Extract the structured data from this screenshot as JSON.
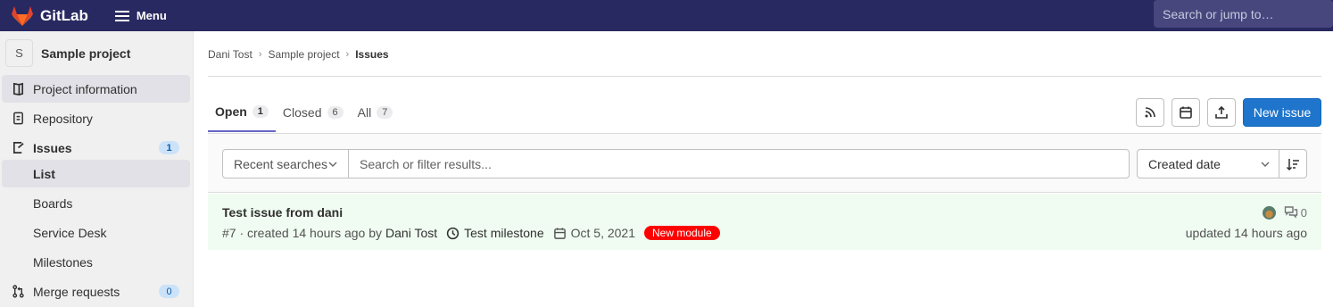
{
  "navbar": {
    "brand": "GitLab",
    "menu_label": "Menu",
    "search_placeholder": "Search or jump to…"
  },
  "sidebar": {
    "project_avatar_letter": "S",
    "project_name": "Sample project",
    "items": [
      {
        "label": "Project information",
        "icon": "book-icon"
      },
      {
        "label": "Repository",
        "icon": "doc-icon"
      },
      {
        "label": "Issues",
        "icon": "issues-icon",
        "count": "1"
      },
      {
        "label": "List"
      },
      {
        "label": "Boards"
      },
      {
        "label": "Service Desk"
      },
      {
        "label": "Milestones"
      },
      {
        "label": "Merge requests",
        "icon": "merge-request-icon",
        "count": "0"
      }
    ]
  },
  "breadcrumb": [
    "Dani Tost",
    "Sample project",
    "Issues"
  ],
  "tabs": [
    {
      "label": "Open",
      "count": "1"
    },
    {
      "label": "Closed",
      "count": "6"
    },
    {
      "label": "All",
      "count": "7"
    }
  ],
  "actions": {
    "new_issue_label": "New issue"
  },
  "filter": {
    "recent_label": "Recent searches",
    "search_placeholder": "Search or filter results...",
    "sort_label": "Created date"
  },
  "issues": [
    {
      "title": "Test issue from dani",
      "ref": "#7 · created 14 hours ago by",
      "author": "Dani Tost",
      "milestone": "Test milestone",
      "due_date": "Oct 5, 2021",
      "label": "New module",
      "label_color": "#ff0000",
      "comments": "0",
      "updated": "updated 14 hours ago"
    }
  ],
  "colors": {
    "navbar": "#292961",
    "primary": "#1f75cb",
    "issue_row_bg": "#f0fcf1"
  }
}
